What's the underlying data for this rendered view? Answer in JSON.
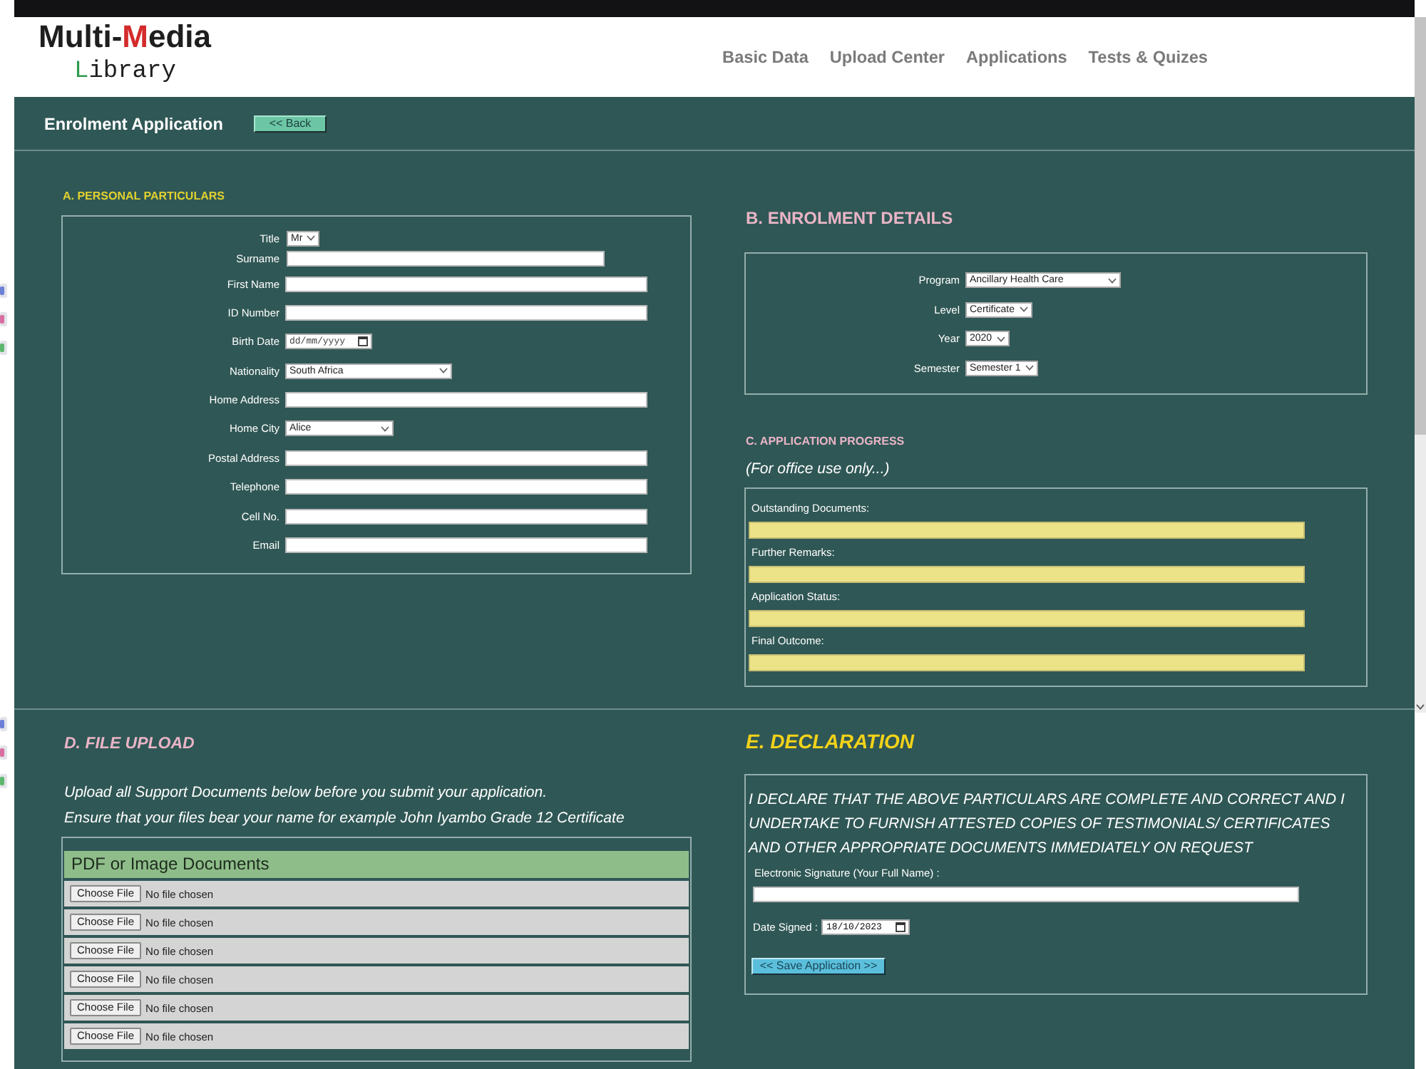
{
  "logo": {
    "title": [
      {
        "text": "Multi-",
        "color": "#1e1e1e"
      },
      {
        "text": "M",
        "color": "#d42b2b"
      },
      {
        "text": "edia",
        "color": "#1e1e1e"
      }
    ],
    "subtitle": [
      {
        "text": "L",
        "color": "#2e9a4e"
      },
      {
        "text": "ibrary",
        "color": "#1e1e1e"
      }
    ]
  },
  "nav": [
    "Basic Data",
    "Upload Center",
    "Applications",
    "Tests & Quizes"
  ],
  "page_header": {
    "title": "Enrolment Application",
    "back_button": "<< Back"
  },
  "personal_particulars": {
    "heading": "A. PERSONAL PARTICULARS",
    "fields": [
      {
        "kind": "select",
        "label": "Title",
        "value": "Mr"
      },
      {
        "kind": "short",
        "label": "Surname"
      },
      {
        "kind": "text",
        "label": "First Name"
      },
      {
        "kind": "text",
        "label": "ID Number"
      },
      {
        "kind": "date",
        "label": "Birth Date",
        "placeholder": "dd/mm/yyyy"
      },
      {
        "kind": "select",
        "label": "Nationality",
        "value": "South Africa"
      },
      {
        "kind": "text",
        "label": "Home Address"
      },
      {
        "kind": "select",
        "label": "Home City",
        "value": "Alice"
      },
      {
        "kind": "text",
        "label": "Postal Address"
      },
      {
        "kind": "text",
        "label": "Telephone"
      },
      {
        "kind": "text",
        "label": "Cell No."
      },
      {
        "kind": "text",
        "label": "Email"
      }
    ]
  },
  "enrolment_details": {
    "heading": "B. ENROLMENT DETAILS",
    "fields": [
      {
        "label": "Program",
        "value": "Ancillary Health Care"
      },
      {
        "label": "Level",
        "value": "Certificate"
      },
      {
        "label": "Year",
        "value": "2020"
      },
      {
        "label": "Semester",
        "value": "Semester 1"
      }
    ]
  },
  "application_progress": {
    "heading": "C. APPLICATION PROGRESS",
    "note": "(For office use only...)",
    "fields": [
      {
        "label": "Outstanding Documents:"
      },
      {
        "label": "Further Remarks:"
      },
      {
        "label": "Application Status:"
      },
      {
        "label": "Final Outcome:"
      }
    ]
  },
  "file_upload": {
    "heading": "D. FILE UPLOAD",
    "instructions": [
      "Upload all Support Documents below before you submit your application.",
      "Ensure that your files bear your name for example John Iyambo Grade 12 Certificate"
    ],
    "table": {
      "title": "PDF or Image Documents",
      "rows": [
        {
          "button": "Choose File",
          "status": "No file chosen"
        },
        {
          "button": "Choose File",
          "status": "No file chosen"
        },
        {
          "button": "Choose File",
          "status": "No file chosen"
        },
        {
          "button": "Choose File",
          "status": "No file chosen"
        },
        {
          "button": "Choose File",
          "status": "No file chosen"
        },
        {
          "button": "Choose File",
          "status": "No file chosen"
        }
      ]
    }
  },
  "declaration": {
    "heading": "E. DECLARATION",
    "statement": "I DECLARE THAT THE ABOVE PARTICULARS ARE COMPLETE AND CORRECT AND I UNDERTAKE TO FURNISH ATTESTED COPIES OF TESTIMONIALS/ CERTIFICATES AND OTHER APPROPRIATE DOCUMENTS IMMEDIATELY ON REQUEST",
    "signature_label": "Electronic Signature (Your Full Name) :",
    "date_label": "Date Signed :",
    "date_value": "18/10/2023",
    "save_button": "<< Save Application >>"
  }
}
